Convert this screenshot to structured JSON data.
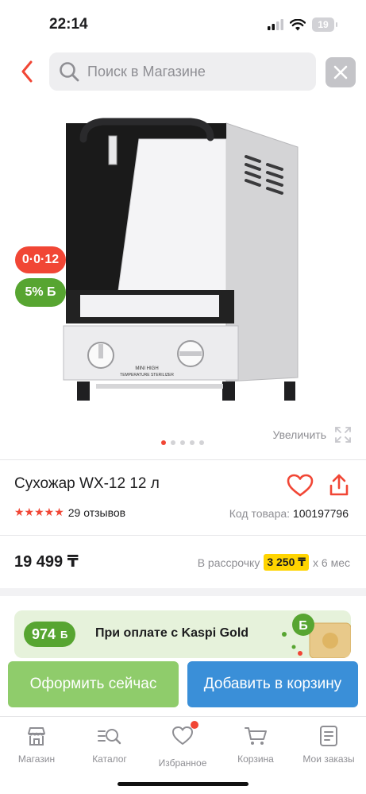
{
  "status_bar": {
    "time": "22:14",
    "battery": "19"
  },
  "search": {
    "placeholder": "Поиск в Магазине"
  },
  "badges": {
    "installment": "0·0·12",
    "bonus": "5% Б"
  },
  "gallery": {
    "zoom_label": "Увеличить",
    "image_count": 5,
    "active_index": 0
  },
  "product": {
    "title": "Сухожар WX-12 12 л",
    "rating": 5,
    "reviews": "29 отзывов",
    "sku_label": "Код товара:",
    "sku_value": "100197796",
    "price": "19 499 ₸",
    "installment_prefix": "В рассрочку",
    "installment_amount": "3 250 ₸",
    "installment_suffix": "х 6 мес"
  },
  "kaspi_gold": {
    "bonus": "974",
    "bonus_mark": "Б",
    "text": "При оплате с Kaspi Gold"
  },
  "actions": {
    "buy_now": "Оформить сейчас",
    "add_to_cart": "Добавить в корзину"
  },
  "tabbar": [
    {
      "label": "Магазин",
      "icon": "store-icon"
    },
    {
      "label": "Каталог",
      "icon": "catalog-search-icon"
    },
    {
      "label": "Избранное",
      "icon": "heart-icon"
    },
    {
      "label": "Корзина",
      "icon": "cart-icon"
    },
    {
      "label": "Мои заказы",
      "icon": "orders-icon"
    }
  ],
  "colors": {
    "accent_red": "#f14635",
    "bonus_green": "#57a531",
    "buy_green": "#8fcc6b",
    "cart_blue": "#3a8fd8",
    "installment_yellow": "#ffd400"
  }
}
